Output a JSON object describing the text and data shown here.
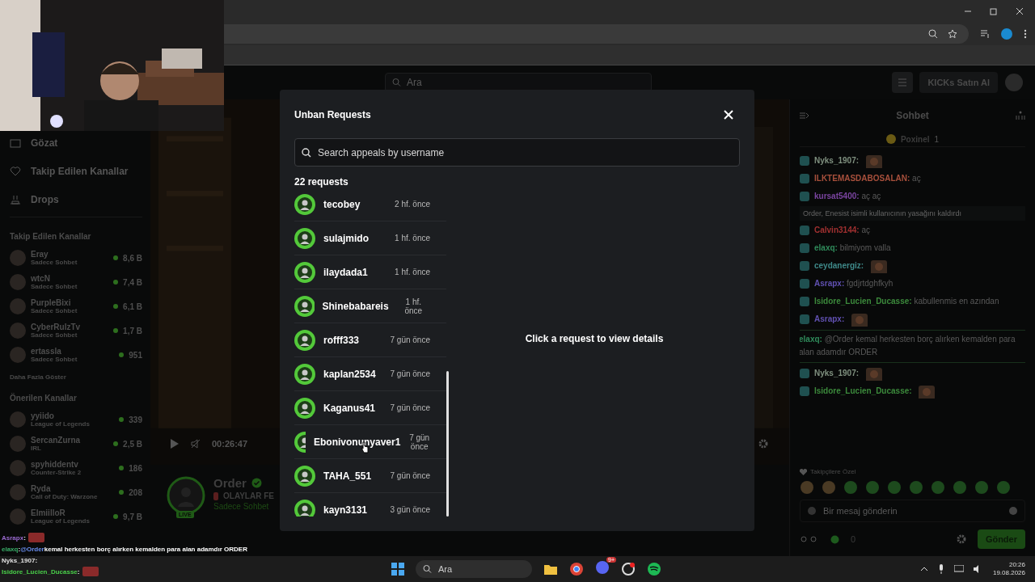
{
  "header": {
    "search_placeholder": "Ara",
    "buy_button": "KICKs Satın Al"
  },
  "sidebar": {
    "nav": [
      {
        "label": "Gözat"
      },
      {
        "label": "Takip Edilen Kanallar"
      },
      {
        "label": "Drops"
      }
    ],
    "followed_title": "Takip Edilen Kanallar",
    "followed": [
      {
        "name": "Eray",
        "category": "Sadece Sohbet",
        "viewers": "8,6 B"
      },
      {
        "name": "wtcN",
        "category": "Sadece Sohbet",
        "viewers": "7,4 B"
      },
      {
        "name": "PurpleBixi",
        "category": "Sadece Sohbet",
        "viewers": "6,1 B"
      },
      {
        "name": "CyberRulzTv",
        "category": "Sadece Sohbet",
        "viewers": "1,7 B"
      },
      {
        "name": "ertassla",
        "category": "Sadece Sohbet",
        "viewers": "951"
      }
    ],
    "show_more": "Daha Fazla Göster",
    "recommended_title": "Önerilen Kanallar",
    "recommended": [
      {
        "name": "yyiido",
        "category": "League of Legends",
        "viewers": "339"
      },
      {
        "name": "SercanZurna",
        "category": "IRL",
        "viewers": "2,5 B"
      },
      {
        "name": "spyhiddentv",
        "category": "Counter-Strike 2",
        "viewers": "186"
      },
      {
        "name": "Ryda",
        "category": "Call of Duty: Warzone",
        "viewers": "208"
      },
      {
        "name": "ElmiilloR",
        "category": "League of Legends",
        "viewers": "9,7 B"
      }
    ]
  },
  "player": {
    "time": "00:26:47",
    "channel": "Order",
    "title": "OLAYLAR FE",
    "status": "Sadece Sohbet",
    "live_badge": "LIVE"
  },
  "chat": {
    "title": "Sohbet",
    "pinned_user": "Poxinel",
    "pinned_count": "1",
    "messages": [
      {
        "kind": "message",
        "user": "Nyks_1907:",
        "color": "#7f907f",
        "emote": true
      },
      {
        "kind": "message",
        "user": "ILKTEMASDABOSALAN:",
        "color": "#a8503c",
        "text": "aç"
      },
      {
        "kind": "message",
        "user": "kursat5400:",
        "color": "#7a44a0",
        "text": "aç aç"
      },
      {
        "kind": "event",
        "text": "Order, Enesist isimli kullanıcının yasağını kaldırdı"
      },
      {
        "kind": "message",
        "user": "Calvin3144:",
        "color": "#a03030",
        "text": "aç"
      },
      {
        "kind": "message",
        "user": "elaxq:",
        "color": "#2f8a5a",
        "text": "bilmiyom valla"
      },
      {
        "kind": "message",
        "user": "ceydanergiz:",
        "color": "#3f8a8a",
        "emote": true
      },
      {
        "kind": "message",
        "user": "Asrapx:",
        "color": "#6050b0",
        "text": "fgdjrtdghfkyh"
      },
      {
        "kind": "message",
        "user": "Isidore_Lucien_Ducasse:",
        "color": "#3c8a3c",
        "text": "kabullenmis en azından"
      },
      {
        "kind": "message",
        "user": "Asrapx:",
        "color": "#6050b0",
        "emote": true
      },
      {
        "kind": "highlight",
        "user": "elaxq:",
        "color": "#2f8a5a",
        "text": "@Order kemal herkesten borç alırken kemalden para alan adamdır ORDER"
      },
      {
        "kind": "message",
        "user": "Nyks_1907:",
        "color": "#7f907f",
        "emote": true
      },
      {
        "kind": "message",
        "user": "Isidore_Lucien_Ducasse:",
        "color": "#3c8a3c",
        "emote": true
      }
    ],
    "emote_section": "Takipçilere Özel",
    "input_placeholder": "Bir mesaj gönderin",
    "points": "0",
    "send_button": "Gönder"
  },
  "modal": {
    "title": "Unban Requests",
    "search_placeholder": "Search appeals by username",
    "count": "22 requests",
    "requests": [
      {
        "name": "tecobey",
        "time": "2 hf. önce"
      },
      {
        "name": "sulajmido",
        "time": "1 hf. önce"
      },
      {
        "name": "ilaydada1",
        "time": "1 hf. önce"
      },
      {
        "name": "Shinebabareis",
        "time": "1 hf. önce"
      },
      {
        "name": "rofff333",
        "time": "7 gün önce"
      },
      {
        "name": "kaplan2534",
        "time": "7 gün önce"
      },
      {
        "name": "Kaganus41",
        "time": "7 gün önce"
      },
      {
        "name": "Ebonivonunyaver1",
        "time": "7 gün önce"
      },
      {
        "name": "TAHA_551",
        "time": "7 gün önce"
      },
      {
        "name": "kayn3131",
        "time": "3 gün önce"
      }
    ],
    "empty_message": "Click a request to view details"
  },
  "stream_overlay": [
    {
      "user": "Asrapx",
      "color": "#9a6ad0",
      "separator": ":",
      "emote": true
    },
    {
      "user": "elaxq",
      "color": "#3ab06a",
      "separator": ":",
      "mention": "@Order",
      "text": "kemal herkesten borç alırken kemalden para alan adamdır ORDER"
    },
    {
      "user": "Nyks_1907",
      "color": "#e0e0e0",
      "separator": ":"
    },
    {
      "user": "Isidore_Lucien_Ducasse",
      "color": "#4ad04a",
      "separator": ":",
      "emote": true
    }
  ],
  "taskbar": {
    "search_placeholder": "Ara",
    "notification_badge": "9+",
    "time": "20:26",
    "date": "19.08.2026"
  }
}
